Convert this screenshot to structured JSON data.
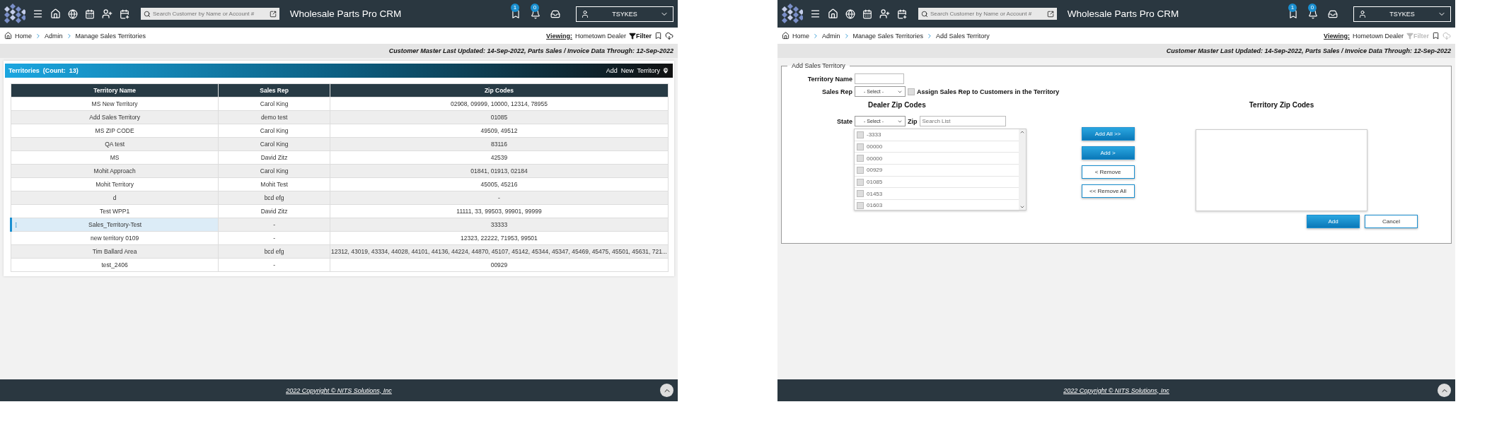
{
  "screens": [
    {
      "kind": "list",
      "header": {
        "search_placeholder": "Search Customer by Name or Account #",
        "title": "Wholesale Parts Pro CRM",
        "bookmark_count": "1",
        "alert_count": "0",
        "user": "TSYKES"
      },
      "breadcrumb": [
        "Home",
        "Admin",
        "Manage Sales Territories"
      ],
      "viewing_label": "Viewing:",
      "viewing_value": "Hometown Dealer",
      "filter": {
        "label": "Filter",
        "disabled": false
      },
      "info": "Customer Master Last Updated: 14-Sep-2022, Parts Sales / Invoice Data Through: 12-Sep-2022",
      "banner": {
        "title": "Territories  (Count:  13)",
        "action": "Add  New  Territory"
      },
      "table": {
        "columns": [
          "Territory Name",
          "Sales Rep",
          "Zip Codes"
        ],
        "rows": [
          {
            "cells": [
              "MS New Territory",
              "Carol King",
              "02908, 09999, 10000, 12314, 78955"
            ],
            "selected": false
          },
          {
            "cells": [
              "Add Sales Territory",
              "demo test",
              "01085"
            ],
            "selected": false
          },
          {
            "cells": [
              "MS ZIP CODE",
              "Carol King",
              "49509, 49512"
            ],
            "selected": false
          },
          {
            "cells": [
              "QA test",
              "Carol King",
              "83116"
            ],
            "selected": false
          },
          {
            "cells": [
              "MS",
              "David Zitz",
              "42539"
            ],
            "selected": false
          },
          {
            "cells": [
              "Mohit Approach",
              "Carol King",
              "01841, 01913, 02184"
            ],
            "selected": false
          },
          {
            "cells": [
              "Mohit Territory",
              "Mohit Test",
              "45005, 45216"
            ],
            "selected": false
          },
          {
            "cells": [
              "d",
              "bcd efg",
              "-"
            ],
            "selected": false
          },
          {
            "cells": [
              "Test WPP1",
              "David Zitz",
              "11111, 33, 99503, 99901, 99999"
            ],
            "selected": false
          },
          {
            "cells": [
              "Sales_Territory-Test",
              "-",
              "33333"
            ],
            "selected": true
          },
          {
            "cells": [
              "new territory 0109",
              "-",
              "12323, 22222, 71953, 99501"
            ],
            "selected": false
          },
          {
            "cells": [
              "Tim Ballard Area",
              "bcd efg",
              "12312, 43019, 43334, 44028, 44101, 44136, 44224, 44870, 45107, 45142, 45344, 45347, 45469, 45475, 45501, 45631, 721..."
            ],
            "selected": false
          },
          {
            "cells": [
              "test_2406",
              "-",
              "00929"
            ],
            "selected": false
          }
        ]
      },
      "footer": "2022 Copyright © NITS Solutions, Inc"
    },
    {
      "kind": "form",
      "header": {
        "search_placeholder": "Search Customer by Name or Account #",
        "title": "Wholesale Parts Pro CRM",
        "bookmark_count": "1",
        "alert_count": "0",
        "user": "TSYKES"
      },
      "breadcrumb": [
        "Home",
        "Admin",
        "Manage Sales Territories",
        "Add Sales Territory"
      ],
      "viewing_label": "Viewing:",
      "viewing_value": "Hometown Dealer",
      "filter": {
        "label": "Filter",
        "disabled": true
      },
      "info": "Customer Master Last Updated: 14-Sep-2022, Parts Sales / Invoice Data Through: 12-Sep-2022",
      "form": {
        "legend": "Add Sales Territory",
        "name_label": "Territory Name",
        "rep_label": "Sales Rep",
        "rep_select": "- Select -",
        "assign_label": "Assign Sales Rep to Customers in the Territory",
        "assign_checked": false,
        "dealer_heading": "Dealer Zip Codes",
        "territory_heading": "Territory Zip Codes",
        "state_label": "State",
        "state_select": "- Select -",
        "zip_label": "Zip",
        "zip_placeholder": "Search List",
        "zips": [
          {
            "label": "-3333",
            "checked": false
          },
          {
            "label": "00000",
            "checked": false
          },
          {
            "label": "00000",
            "checked": false
          },
          {
            "label": "00929",
            "checked": false
          },
          {
            "label": "01085",
            "checked": false
          },
          {
            "label": "01453",
            "checked": false
          },
          {
            "label": "01603",
            "checked": false
          }
        ],
        "move_buttons": [
          {
            "label": "Add All >>",
            "primary": true
          },
          {
            "label": "Add >",
            "primary": true
          },
          {
            "label": "< Remove",
            "primary": false
          },
          {
            "label": "<< Remove All",
            "primary": false
          }
        ],
        "actions": [
          {
            "label": "Add",
            "primary": true
          },
          {
            "label": "Cancel",
            "primary": false
          }
        ]
      },
      "footer": "2022 Copyright © NITS Solutions, Inc"
    }
  ]
}
